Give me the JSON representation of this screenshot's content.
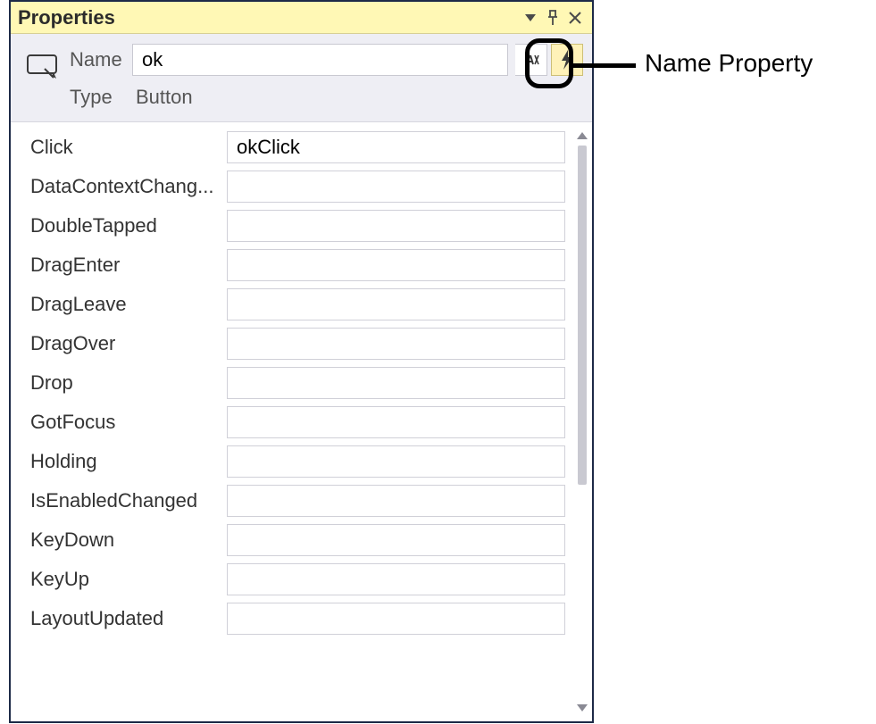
{
  "panel": {
    "title": "Properties"
  },
  "header": {
    "name_label": "Name",
    "name_value": "ok",
    "type_label": "Type",
    "type_value": "Button"
  },
  "events": [
    {
      "label": "Click",
      "value": "okClick"
    },
    {
      "label": "DataContextChang...",
      "value": ""
    },
    {
      "label": "DoubleTapped",
      "value": ""
    },
    {
      "label": "DragEnter",
      "value": ""
    },
    {
      "label": "DragLeave",
      "value": ""
    },
    {
      "label": "DragOver",
      "value": ""
    },
    {
      "label": "Drop",
      "value": ""
    },
    {
      "label": "GotFocus",
      "value": ""
    },
    {
      "label": "Holding",
      "value": ""
    },
    {
      "label": "IsEnabledChanged",
      "value": ""
    },
    {
      "label": "KeyDown",
      "value": ""
    },
    {
      "label": "KeyUp",
      "value": ""
    },
    {
      "label": "LayoutUpdated",
      "value": ""
    }
  ],
  "callout": {
    "label": "Name Property"
  }
}
